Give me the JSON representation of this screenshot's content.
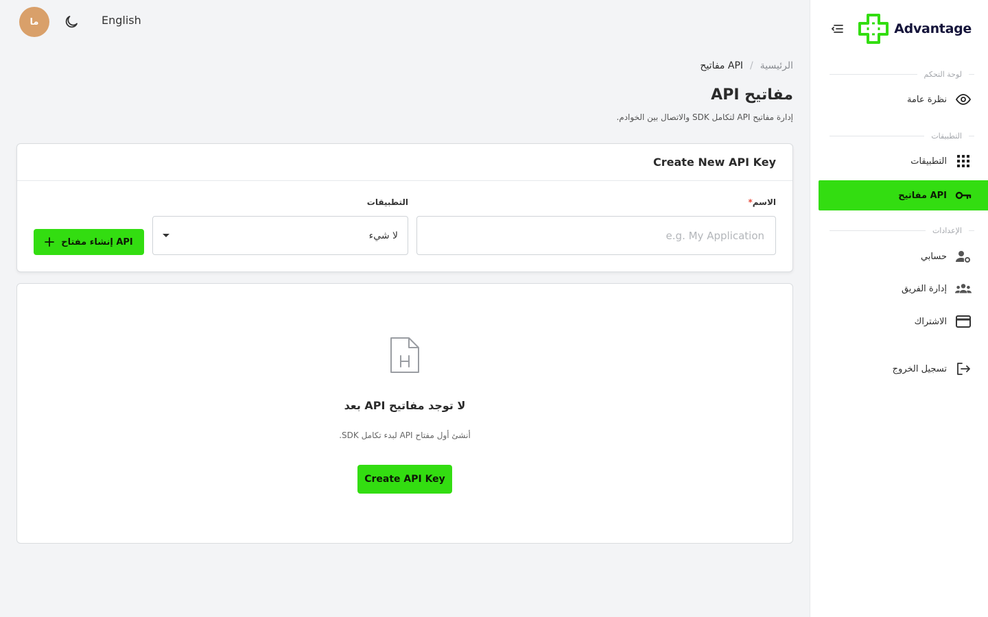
{
  "topbar": {
    "avatar_initials": "ما",
    "theme_icon": "moon-icon",
    "language_label": "English"
  },
  "sidebar": {
    "logo_text": "Advantage",
    "collapse_icon": "menu-collapse-icon",
    "sections": {
      "dashboard": "لوحة التحكم",
      "applications": "التطبيقات",
      "settings": "الإعدادات"
    },
    "items": [
      {
        "label": "نظرة عامة",
        "icon": "eye-icon"
      },
      {
        "label": "التطبيقات",
        "icon": "grid-icon"
      },
      {
        "label": "مفاتيح API",
        "icon": "key-icon",
        "active": true
      },
      {
        "label": "حسابي",
        "icon": "user-settings-icon"
      },
      {
        "label": "إدارة الفريق",
        "icon": "team-icon"
      },
      {
        "label": "الاشتراك",
        "icon": "credit-card-icon"
      },
      {
        "label": "تسجيل الخروج",
        "icon": "logout-icon"
      }
    ]
  },
  "header": {
    "breadcrumb_home": "الرئيسية",
    "breadcrumb_separator": "/",
    "breadcrumb_current": "مفاتيح API",
    "title": "مفاتيح API",
    "subtitle": "إدارة مفاتيح API لتكامل SDK والاتصال بين الخوادم."
  },
  "create_card": {
    "title": "Create New API Key",
    "name_label": "الاسم",
    "name_required_mark": "*",
    "name_placeholder": "e.g. My Application",
    "name_value": "",
    "apps_label": "التطبيقات",
    "apps_value": "لا شيء",
    "submit_label": "إنشاء مفتاح API"
  },
  "empty_state": {
    "icon": "file-icon",
    "title": "لا توجد مفاتيح API بعد",
    "description": "أنشئ أول مفتاح API لبدء تكامل SDK.",
    "button_label": "Create API Key"
  },
  "colors": {
    "accent": "#33dd11",
    "avatar": "#d9a06a",
    "logo_dark": "#15143a"
  }
}
